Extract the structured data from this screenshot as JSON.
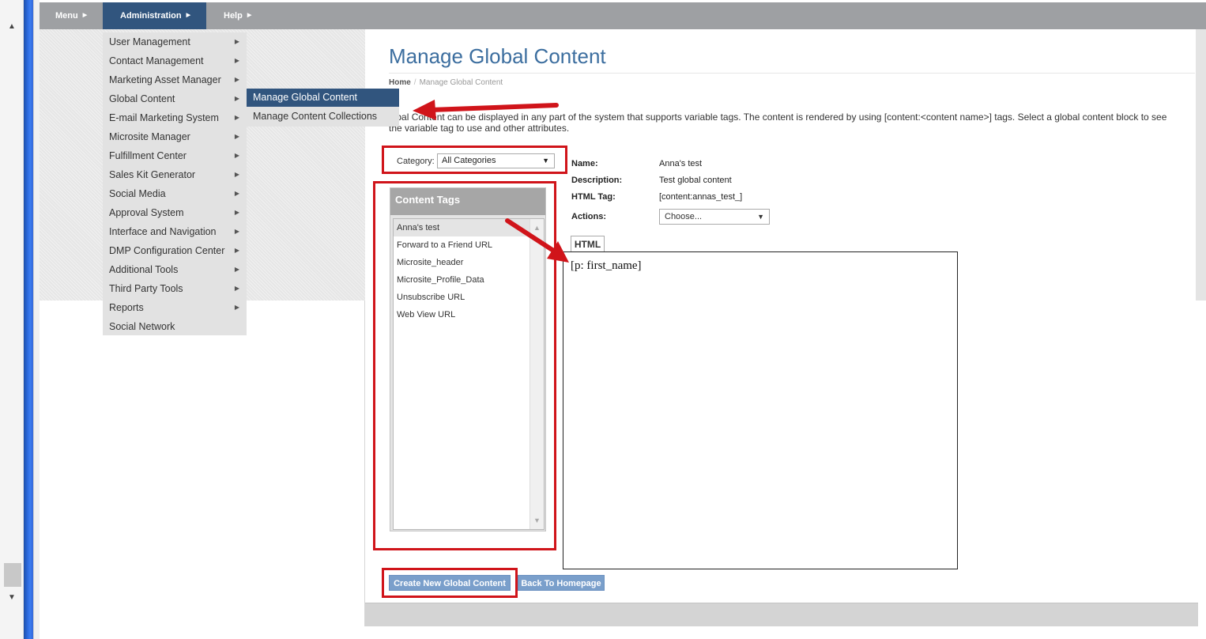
{
  "topbar": {
    "menu": "Menu",
    "administration": "Administration",
    "help": "Help"
  },
  "admin_menu": {
    "items": [
      {
        "label": "User Management",
        "has_sub": true
      },
      {
        "label": "Contact Management",
        "has_sub": true
      },
      {
        "label": "Marketing Asset Manager",
        "has_sub": true
      },
      {
        "label": "Global Content",
        "has_sub": true
      },
      {
        "label": "E-mail Marketing System",
        "has_sub": true
      },
      {
        "label": "Microsite Manager",
        "has_sub": true
      },
      {
        "label": "Fulfillment Center",
        "has_sub": true
      },
      {
        "label": "Sales Kit Generator",
        "has_sub": true
      },
      {
        "label": "Social Media",
        "has_sub": true
      },
      {
        "label": "Approval System",
        "has_sub": true
      },
      {
        "label": "Interface and Navigation",
        "has_sub": true
      },
      {
        "label": "DMP Configuration Center",
        "has_sub": true
      },
      {
        "label": "Additional Tools",
        "has_sub": true
      },
      {
        "label": "Third Party Tools",
        "has_sub": true
      },
      {
        "label": "Reports",
        "has_sub": true
      },
      {
        "label": "Social Network",
        "has_sub": false
      }
    ]
  },
  "submenu": {
    "active": "Manage Global Content",
    "second": "Manage Content Collections"
  },
  "page": {
    "title": "Manage Global Content",
    "breadcrumb_home": "Home",
    "breadcrumb_sep": "/",
    "breadcrumb_current": "Manage Global Content",
    "intro": "lobal Content can be displayed in any part of the system that supports variable tags. The content is rendered by using [content:<content name>] tags. Select a global content block to see the variable tag to use and other attributes."
  },
  "category": {
    "label": "Category:",
    "selected": "All Categories"
  },
  "content_tags": {
    "header": "Content Tags",
    "items": [
      "Anna's test",
      "Forward to a Friend URL",
      "Microsite_header",
      "Microsite_Profile_Data",
      "Unsubscribe URL",
      "Web View URL"
    ],
    "selected_index": 0
  },
  "details": {
    "name_label": "Name:",
    "name_value": "Anna's test",
    "description_label": "Description:",
    "description_value": "Test global content",
    "html_tag_label": "HTML Tag:",
    "html_tag_value": "[content:annas_test_]",
    "actions_label": "Actions:",
    "actions_selected": "Choose..."
  },
  "editor": {
    "tab": "HTML",
    "content": "[p: first_name]"
  },
  "buttons": {
    "create": "Create New Global Content",
    "back": "Back To Homepage"
  },
  "colors": {
    "menu_active": "#31557e",
    "title": "#3c6e9f",
    "annotation": "#d0141a",
    "button": "#7a9fcb"
  }
}
